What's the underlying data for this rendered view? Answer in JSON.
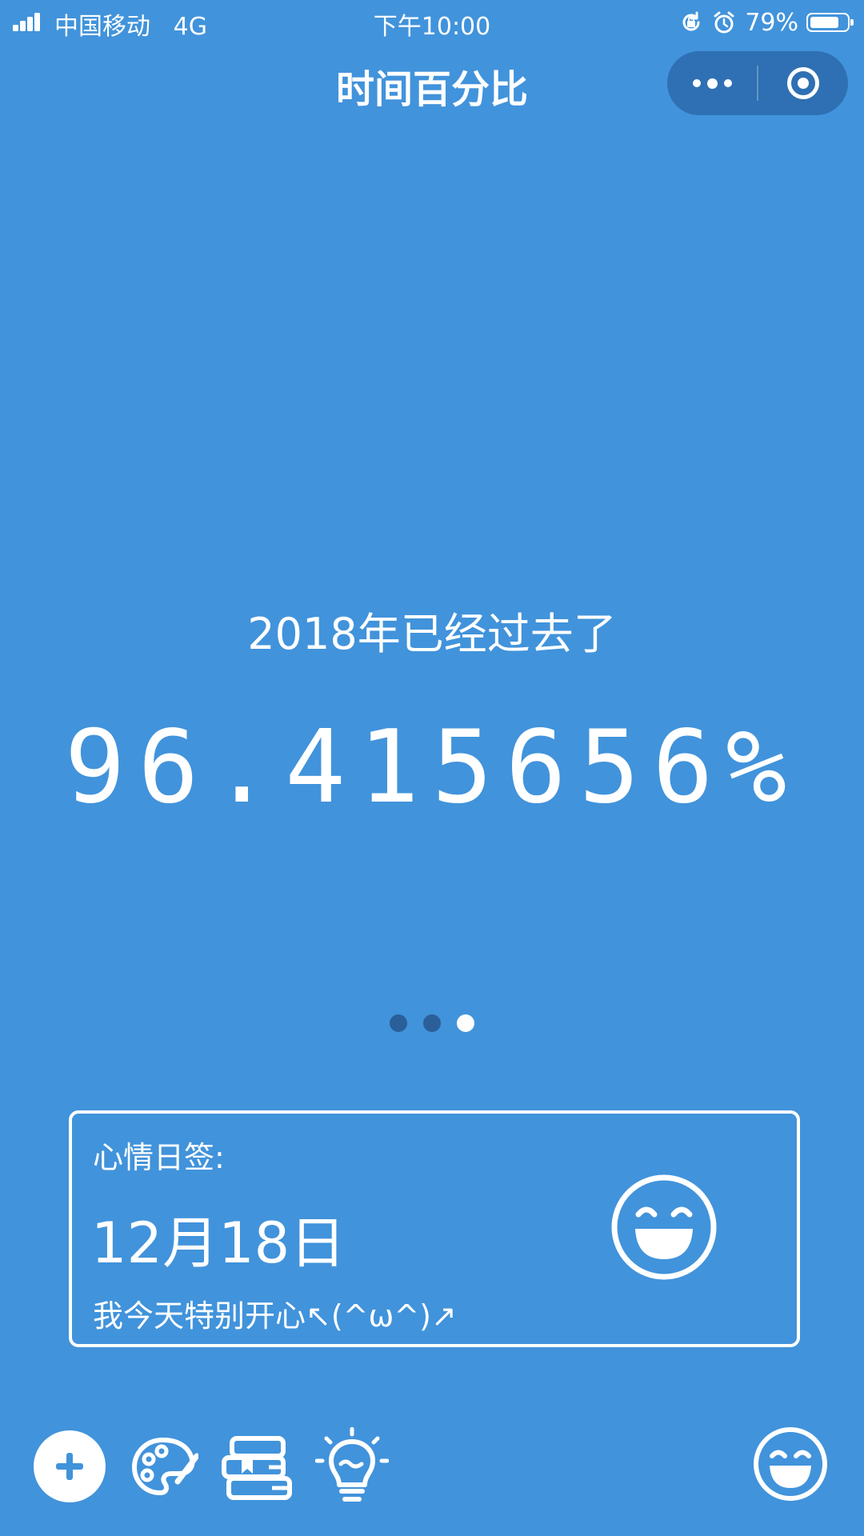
{
  "status_bar": {
    "carrier": "中国移动",
    "network": "4G",
    "time": "下午10:00",
    "battery": "79%",
    "battery_level": 0.79,
    "icons": [
      "signal-icon",
      "rotation-lock-icon",
      "alarm-icon",
      "battery-icon"
    ]
  },
  "nav": {
    "title": "时间百分比",
    "capsule_icons": [
      "more-icon",
      "close-target-icon"
    ]
  },
  "main": {
    "year_label": "2018年已经过去了",
    "percent": "96.415656%",
    "pager_total": 3,
    "pager_active": 3
  },
  "mood_card": {
    "label": "心情日签:",
    "date": "12月18日",
    "text": "我今天特别开心↖(^ω^)↗",
    "icon": "smile-face-icon"
  },
  "toolbar": {
    "icons": [
      "add-icon",
      "palette-icon",
      "books-icon",
      "lightbulb-icon",
      "smile-face-icon"
    ]
  },
  "colors": {
    "background": "#4193db",
    "capsule": "#2e70b3",
    "pager_inactive": "#2a5f9a",
    "foreground": "#ffffff"
  }
}
